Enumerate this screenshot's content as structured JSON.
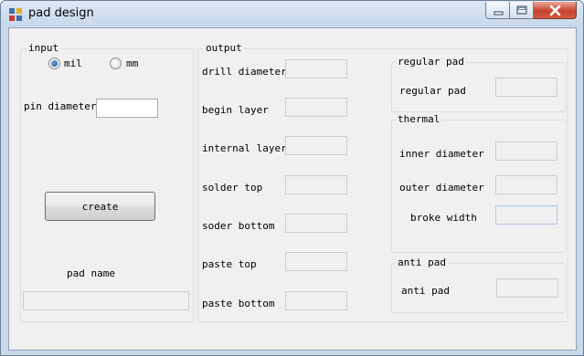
{
  "window": {
    "title": "pad design"
  },
  "input": {
    "legend": "input",
    "unit_mil": "mil",
    "unit_mm": "mm",
    "selected_unit": "mil",
    "pin_diameter_label": "pin diameter",
    "pin_diameter_value": "",
    "create_label": "create",
    "pad_name_label": "pad name",
    "pad_name_value": ""
  },
  "output": {
    "legend": "output",
    "fields": [
      {
        "label": "drill diameter",
        "value": ""
      },
      {
        "label": "begin layer",
        "value": ""
      },
      {
        "label": "internal layer",
        "value": ""
      },
      {
        "label": "solder top",
        "value": ""
      },
      {
        "label": "soder bottom",
        "value": ""
      },
      {
        "label": "paste top",
        "value": ""
      },
      {
        "label": "paste bottom",
        "value": ""
      }
    ]
  },
  "regular_pad": {
    "legend": "regular pad",
    "label": "regular pad",
    "value": ""
  },
  "thermal": {
    "legend": "thermal",
    "inner_label": "inner diameter",
    "inner_value": "",
    "outer_label": "outer diameter",
    "outer_value": "",
    "broke_label": "broke width",
    "broke_value": ""
  },
  "anti_pad": {
    "legend": "anti pad",
    "label": "anti  pad",
    "value": ""
  },
  "colors": {
    "client_bg": "#f0f0f0",
    "titlebar": "#c6d7ea",
    "close_button": "#c7432b"
  }
}
